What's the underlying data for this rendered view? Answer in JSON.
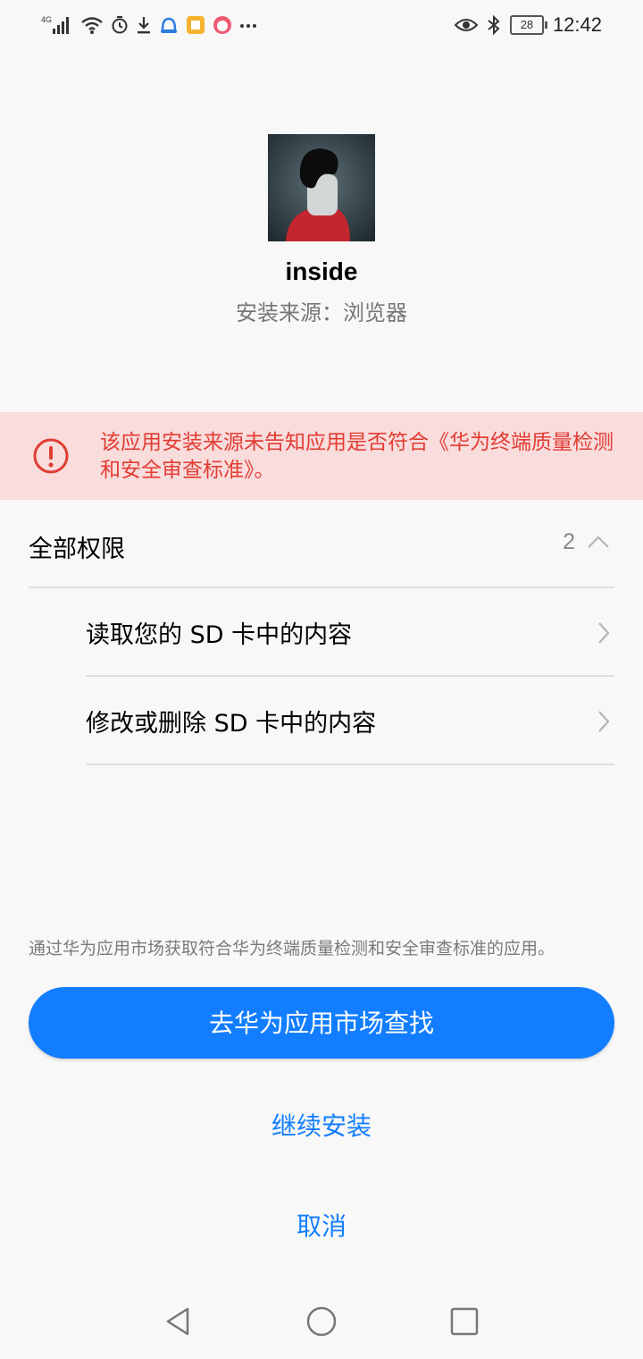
{
  "status_bar": {
    "network": "4G",
    "battery": "28",
    "time": "12:42"
  },
  "app": {
    "name": "inside",
    "source": "安装来源：浏览器"
  },
  "warning": {
    "text": "该应用安装来源未告知应用是否符合《华为终端质量检测和安全审查标准》。"
  },
  "permissions": {
    "title": "全部权限",
    "count": "2",
    "items": [
      {
        "label": "读取您的 SD 卡中的内容"
      },
      {
        "label": "修改或删除 SD 卡中的内容"
      }
    ]
  },
  "footer": {
    "info": "通过华为应用市场获取符合华为终端质量检测和安全审查标准的应用。",
    "primary_button": "去华为应用市场查找",
    "continue_button": "继续安装",
    "cancel_button": "取消"
  },
  "colors": {
    "accent": "#127eff",
    "warning_bg": "#f9dcdc",
    "warning_text": "#e23c33"
  },
  "icons": {
    "status_left": [
      "signal-icon",
      "wifi-icon",
      "alarm-icon",
      "download-icon",
      "app-notification-icon",
      "more-icon"
    ],
    "status_right": [
      "eye-icon",
      "bluetooth-icon",
      "battery-icon"
    ],
    "nav": [
      "back-icon",
      "home-icon",
      "recents-icon"
    ]
  }
}
